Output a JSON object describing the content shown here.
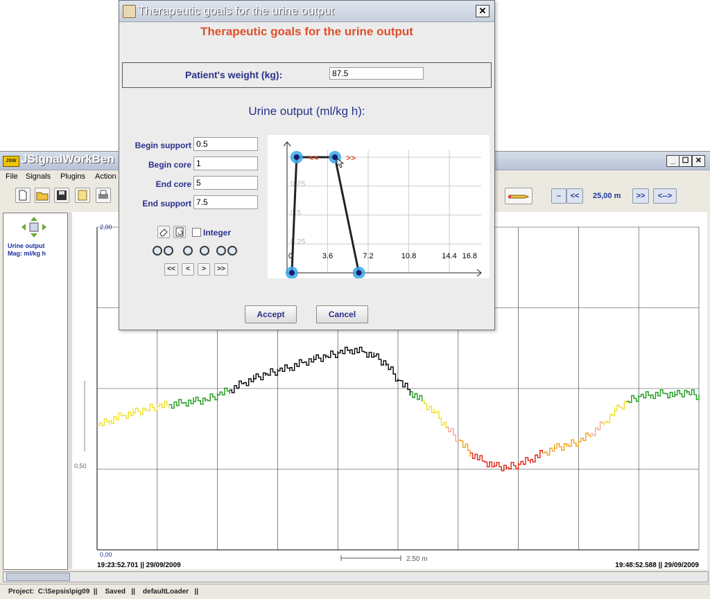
{
  "main_window": {
    "title": "JSignalWorkBen",
    "logo_text": "JSW",
    "min_glyph": "_",
    "max_glyph": "☐",
    "close_glyph": "✕",
    "menu": [
      "File",
      "Signals",
      "Plugins",
      "Action"
    ],
    "nav": {
      "minus_label": "–",
      "back_label": "<<",
      "zoom_value": "25,00 m",
      "forward_label": ">>",
      "fit_label": "<-->",
      "partial_label": "/)"
    },
    "signal_panel": {
      "name": "Urine output",
      "magnitude": "Mag: ml/kg h"
    },
    "status": {
      "project": "Project:  C:\\Sepsis\\pig09  ||    Saved   ||    defaultLoader   ||"
    }
  },
  "chart_data": {
    "type": "line",
    "y_tick_labels": [
      "2,00",
      "0,50",
      "0,00"
    ],
    "start_time": "19:23:52.701 || 29/09/2009",
    "end_time": "19:48:52.588 || 29/09/2009",
    "scale_bar_label": "2,50 m",
    "x": [
      0,
      0.5,
      1,
      1.5,
      2,
      2.5,
      3,
      3.5,
      4,
      4.5,
      5,
      5.5,
      6,
      6.5,
      7,
      7.5,
      8,
      8.5,
      9,
      9.5,
      10,
      10.5,
      11,
      11.5,
      12,
      12.5,
      13,
      13.5,
      14,
      14.5,
      15,
      15.5,
      16,
      16.5,
      17,
      17.5,
      18,
      18.5,
      19,
      19.5,
      20,
      20.5,
      21,
      21.5,
      22,
      22.5,
      23,
      23.5,
      24,
      24.5,
      25
    ],
    "values": [
      0.77,
      0.8,
      0.83,
      0.85,
      0.87,
      0.89,
      0.9,
      0.91,
      0.92,
      0.93,
      0.96,
      0.99,
      1.03,
      1.06,
      1.09,
      1.11,
      1.13,
      1.16,
      1.18,
      1.2,
      1.22,
      1.24,
      1.23,
      1.2,
      1.15,
      1.05,
      0.98,
      0.92,
      0.85,
      0.76,
      0.68,
      0.6,
      0.55,
      0.52,
      0.51,
      0.53,
      0.56,
      0.6,
      0.63,
      0.65,
      0.67,
      0.72,
      0.78,
      0.86,
      0.92,
      0.95,
      0.96,
      0.97,
      0.96,
      0.98,
      0.95
    ],
    "color_bands": {
      "black": "#000000",
      "green": "#1a9a1a",
      "yellow": "#f0e020",
      "pink": "#f0a898",
      "orange": "#f0a020",
      "red": "#e02010"
    }
  },
  "dialog": {
    "title": "Therapeutic goals for the urine output",
    "heading": "Therapeutic goals for the urine output",
    "close_glyph": "✕",
    "weight_label": "Patient's weight (kg):",
    "weight_value": "87.5",
    "urine_heading": "Urine output (ml/kg h):",
    "params": [
      {
        "label": "Begin support",
        "value": "0.5"
      },
      {
        "label": "Begin core",
        "value": "1"
      },
      {
        "label": "End core",
        "value": "5"
      },
      {
        "label": "End support",
        "value": "7.5"
      }
    ],
    "integer_label": "Integer",
    "nav_buttons": [
      "<<",
      "<",
      ">",
      ">>"
    ],
    "accept_label": "Accept",
    "cancel_label": "Cancel",
    "goal_chart": {
      "x_tick_labels": [
        "0",
        "3.6",
        "7.2",
        "10.8",
        "14.4",
        "16.8"
      ],
      "y_tick_labels": [
        "0.75",
        "0.5",
        "0.25"
      ],
      "arrow_left": "<<",
      "arrow_right": ">>",
      "points": [
        [
          0.5,
          0
        ],
        [
          1,
          1
        ],
        [
          5,
          1
        ],
        [
          7.5,
          0
        ]
      ]
    }
  }
}
